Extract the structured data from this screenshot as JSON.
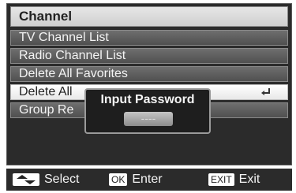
{
  "menu": {
    "title": "Channel",
    "items": [
      {
        "label": "TV Channel List"
      },
      {
        "label": "Radio Channel List"
      },
      {
        "label": "Delete All Favorites"
      },
      {
        "label": "Delete All",
        "selected": true,
        "icon": "enter-icon"
      },
      {
        "label": "Group Re"
      }
    ]
  },
  "dialog": {
    "title": "Input Password",
    "password_value": "----"
  },
  "footer": {
    "select_key_icon": "up-down-arrows-icon",
    "select_label": "Select",
    "ok_key": "OK",
    "enter_label": "Enter",
    "exit_key": "EXIT",
    "exit_label": "Exit"
  },
  "colors": {
    "panel_bg": "#2b2b2b",
    "item_bg": "#5f5f5f",
    "selected_bg": "#f2f2f2",
    "text_light": "#f4f4f4"
  }
}
